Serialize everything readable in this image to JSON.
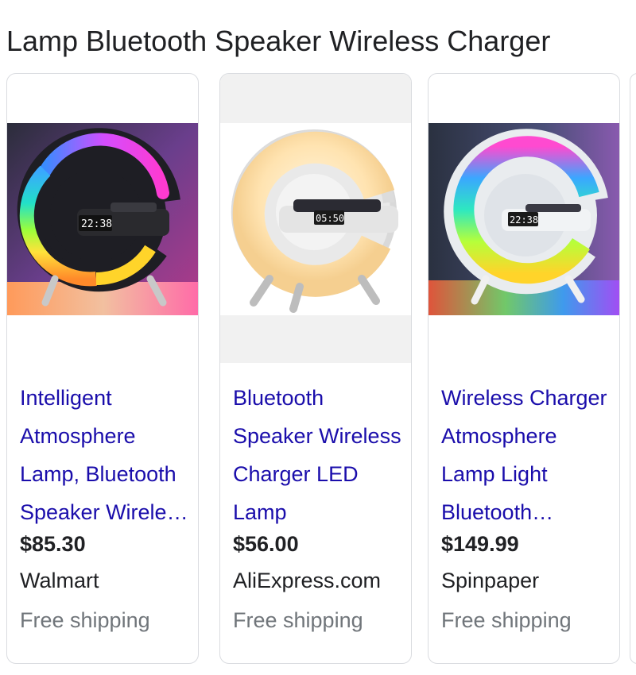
{
  "heading": "Lamp Bluetooth Speaker Wireless Charger",
  "products": [
    {
      "title": "Intelligent Atmosphere Lamp, Bluetooth Speaker Wireless Charger",
      "price": "$85.30",
      "seller": "Walmart",
      "shipping": "Free shipping",
      "image_label": "RGB G-shaped lamp with clock display",
      "clock": "22:38"
    },
    {
      "title": "Bluetooth Speaker Wireless Charger LED Lamp",
      "price": "$56.00",
      "seller": "AliExpress.com",
      "shipping": "Free shipping",
      "image_label": "White G-shaped lamp with warm light",
      "clock": "05:50"
    },
    {
      "title": "Wireless Charger Atmosphere Lamp Light Bluetooth Speaker",
      "price": "$149.99",
      "seller": "Spinpaper",
      "shipping": "Free shipping",
      "image_label": "White G-shaped lamp with RGB light",
      "clock": "22:38"
    }
  ]
}
